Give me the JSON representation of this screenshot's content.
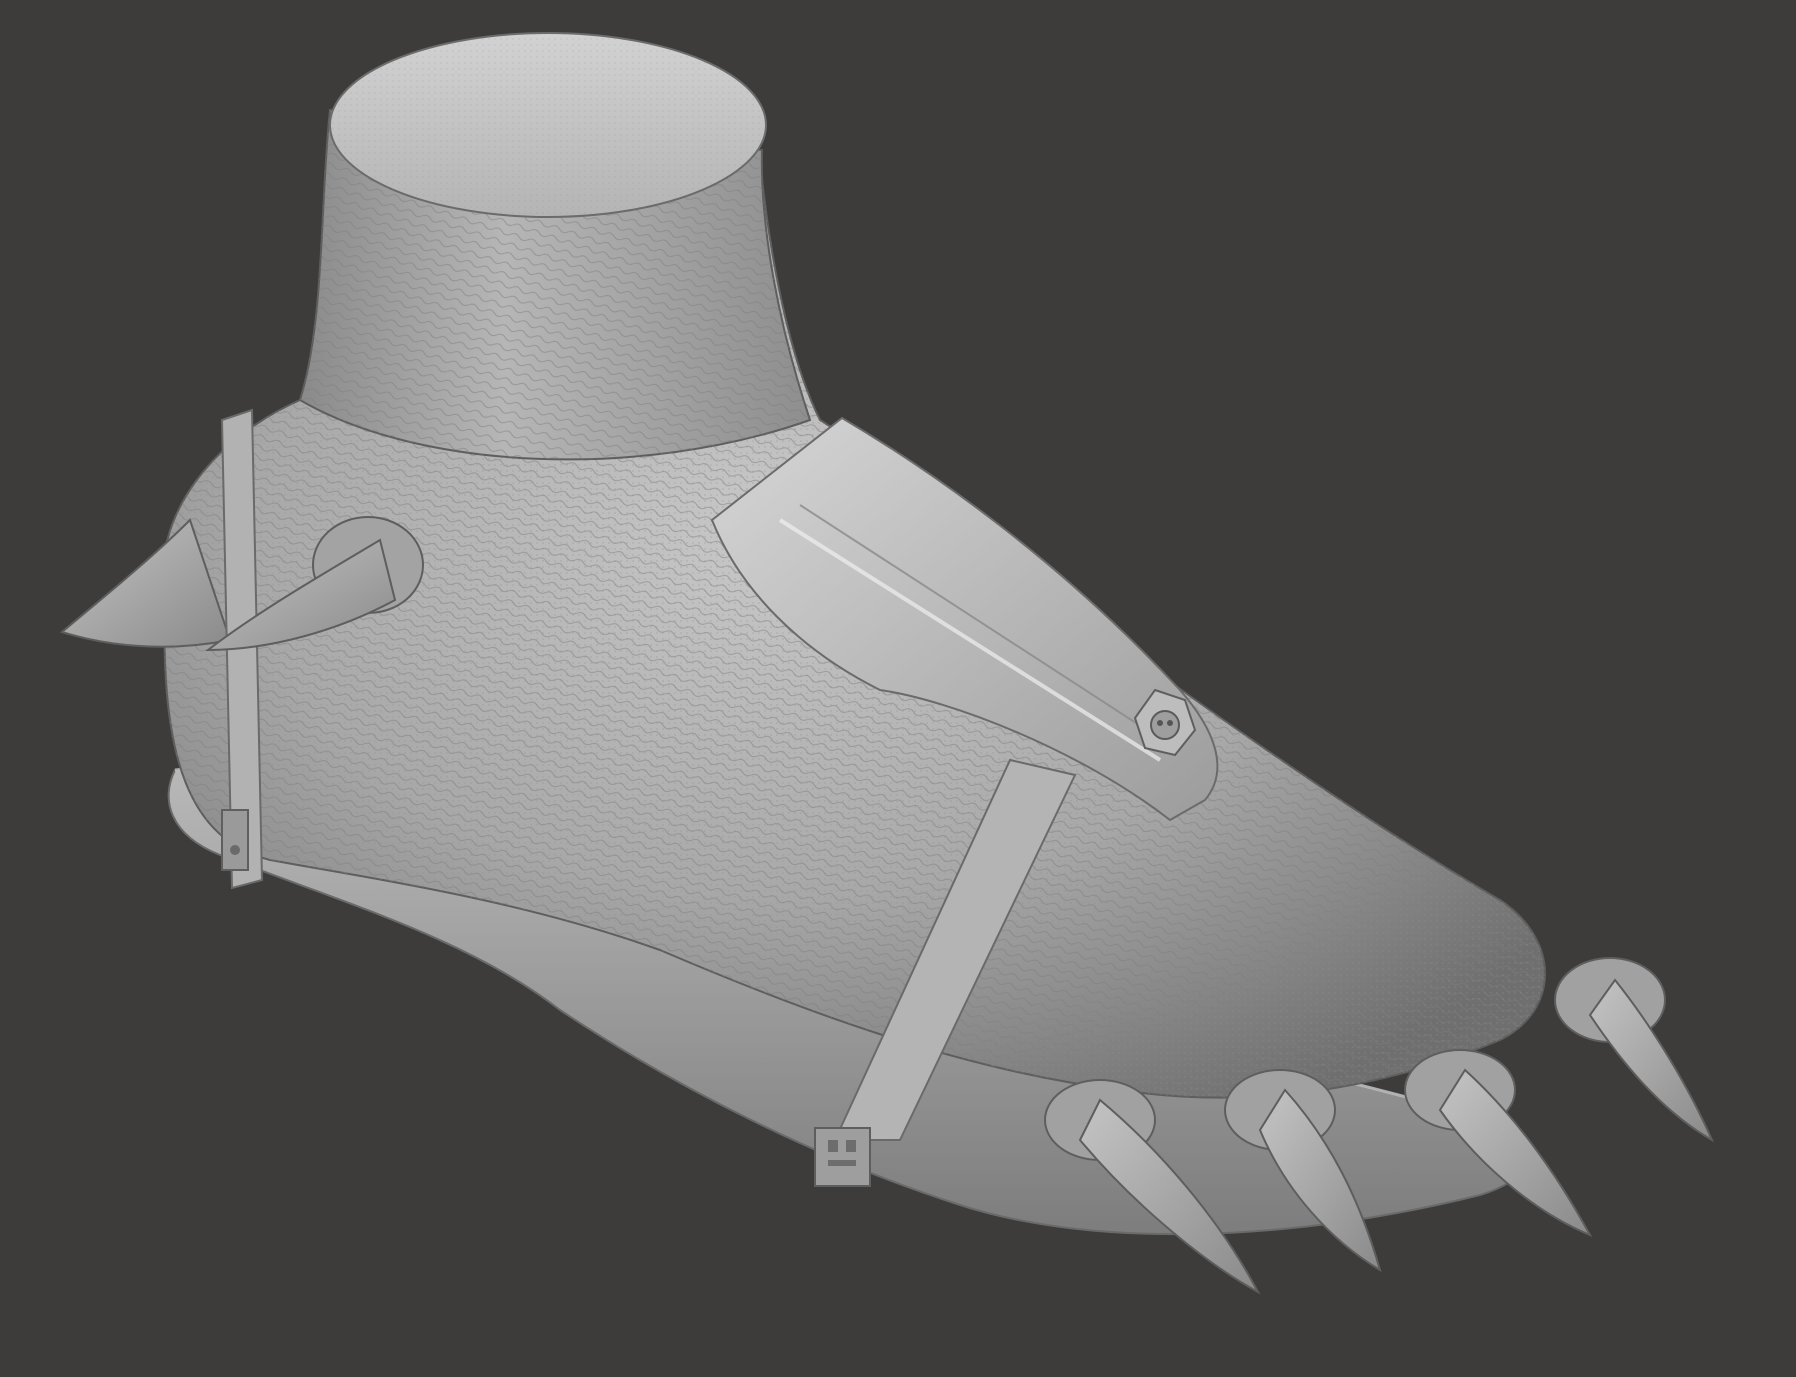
{
  "viewport": {
    "background": "#3d3c3a",
    "model_color": "#a9a9a9",
    "subject": "sculpted-creature-foot-in-sandal"
  },
  "model_parts": [
    {
      "name": "ankle-stump-cap"
    },
    {
      "name": "ankle-shaft"
    },
    {
      "name": "heel-spike"
    },
    {
      "name": "ankle-spike"
    },
    {
      "name": "foot-body"
    },
    {
      "name": "sandal-sole"
    },
    {
      "name": "instep-armor-plate"
    },
    {
      "name": "armor-medallion"
    },
    {
      "name": "heel-strap"
    },
    {
      "name": "toe-strap"
    },
    {
      "name": "toe-claw-1"
    },
    {
      "name": "toe-claw-2"
    },
    {
      "name": "toe-claw-3"
    },
    {
      "name": "toe-claw-4"
    }
  ]
}
